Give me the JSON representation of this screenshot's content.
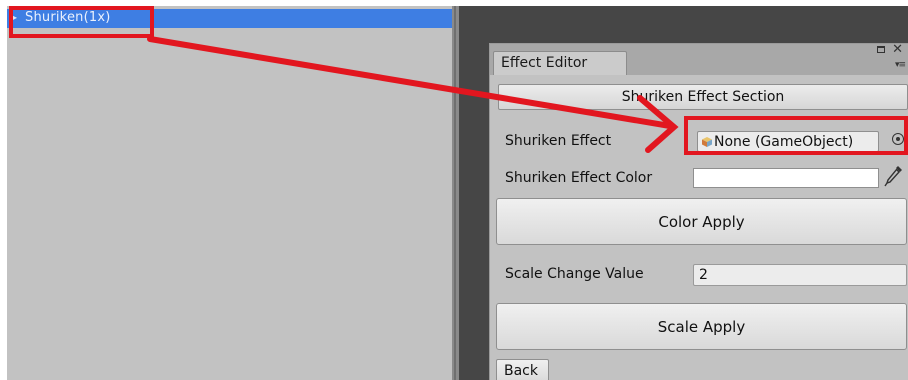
{
  "hierarchy": {
    "selected_item": "Shuriken(1x)"
  },
  "window": {
    "tab_label": "Effect Editor",
    "section_button": "Shuriken Effect Section",
    "shuriken_effect": {
      "label": "Shuriken Effect",
      "value": "None (GameObject)"
    },
    "shuriken_effect_color": {
      "label": "Shuriken Effect Color",
      "value": ""
    },
    "color_apply_button": "Color Apply",
    "scale_change_value": {
      "label": "Scale Change Value",
      "value": "2"
    },
    "scale_apply_button": "Scale Apply",
    "back_button": "Back"
  },
  "colors": {
    "selection": "#3e7ee3",
    "panel": "#c2c2c2",
    "dark_background": "#464646",
    "annotation_red": "#e2161f"
  },
  "icons": [
    "cube-icon",
    "object-picker-target-icon",
    "eyedropper-icon",
    "maximize-icon",
    "close-icon",
    "window-menu-icon"
  ]
}
